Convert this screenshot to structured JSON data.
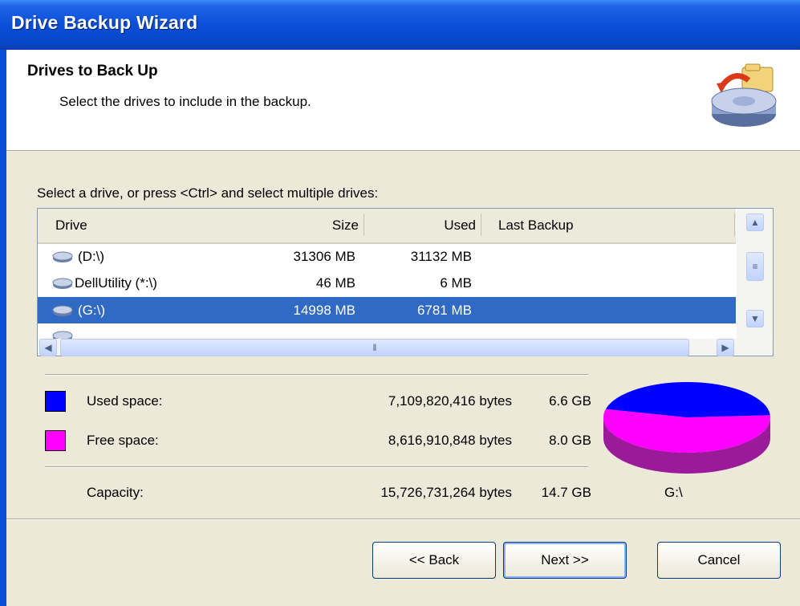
{
  "window": {
    "title": "Drive Backup Wizard"
  },
  "header": {
    "title": "Drives to Back Up",
    "subtitle": "Select the drives to include in the backup."
  },
  "instructions": "Select a drive, or press <Ctrl> and select multiple drives:",
  "drive_list": {
    "columns": [
      "Drive",
      "Size",
      "Used",
      "Last Backup"
    ],
    "rows": [
      {
        "drive": "(D:\\)",
        "size": "31306 MB",
        "used": "31132 MB",
        "last_backup": "",
        "selected": false
      },
      {
        "drive": "DellUtility (*:\\)",
        "size": "46 MB",
        "used": "6 MB",
        "last_backup": "",
        "selected": false
      },
      {
        "drive": "(G:\\)",
        "size": "14998 MB",
        "used": "6781 MB",
        "last_backup": "",
        "selected": true
      }
    ]
  },
  "space": {
    "used": {
      "label": "Used space:",
      "bytes": "7,109,820,416 bytes",
      "size": "6.6 GB",
      "color": "#0000ff"
    },
    "free": {
      "label": "Free space:",
      "bytes": "8,616,910,848 bytes",
      "size": "8.0 GB",
      "color": "#ff00ff"
    },
    "capacity": {
      "label": "Capacity:",
      "bytes": "15,726,731,264 bytes",
      "size": "14.7 GB"
    },
    "drive_label": "G:\\",
    "used_fraction": 0.452
  },
  "buttons": {
    "back": "<< Back",
    "next": "Next >>",
    "cancel": "Cancel"
  }
}
